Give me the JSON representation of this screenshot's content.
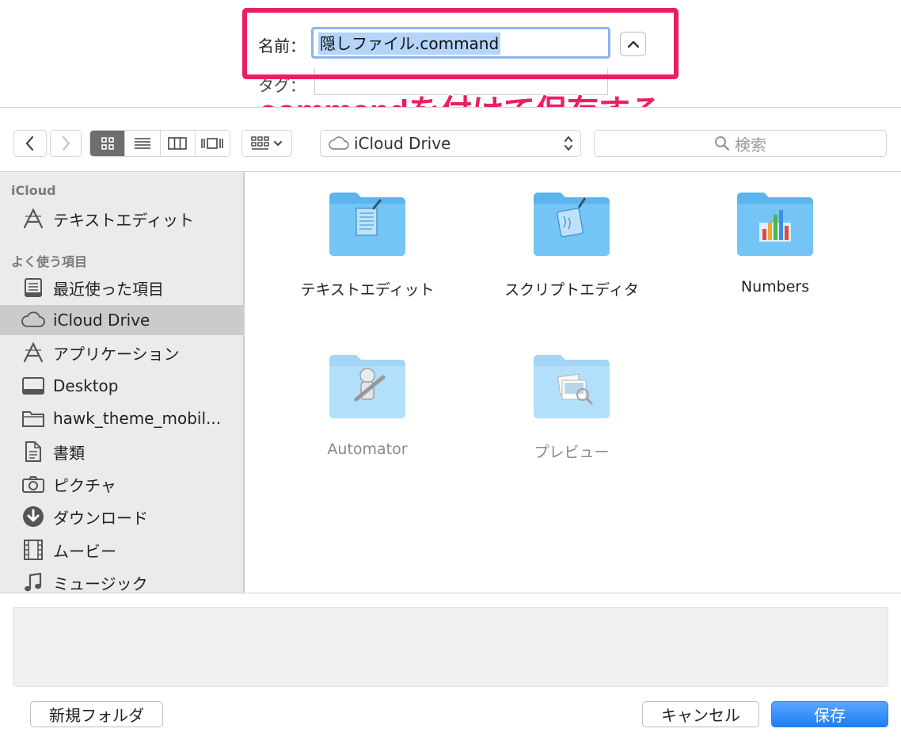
{
  "save_panel": {
    "name_label": "名前：",
    "name_value": "隠しファイル.command",
    "tag_label": "タグ：",
    "annotation": ".commandを付けて保存する",
    "annotation_color": "#ea1f63"
  },
  "toolbar": {
    "location": "iCloud Drive",
    "search_placeholder": "検索"
  },
  "sidebar": {
    "sections": [
      {
        "heading": "iCloud",
        "items": [
          {
            "label": "テキストエディット",
            "icon": "app-icon"
          }
        ]
      },
      {
        "heading": "よく使う項目",
        "items": [
          {
            "label": "最近使った項目",
            "icon": "recents-icon"
          },
          {
            "label": "iCloud Drive",
            "icon": "cloud-icon",
            "selected": true
          },
          {
            "label": "アプリケーション",
            "icon": "app-icon"
          },
          {
            "label": "Desktop",
            "icon": "desktop-icon"
          },
          {
            "label": "hawk_theme_mobil...",
            "icon": "folder-icon"
          },
          {
            "label": "書類",
            "icon": "document-icon"
          },
          {
            "label": "ピクチャ",
            "icon": "camera-icon"
          },
          {
            "label": "ダウンロード",
            "icon": "download-icon"
          },
          {
            "label": "ムービー",
            "icon": "film-icon"
          },
          {
            "label": "ミュージック",
            "icon": "music-icon"
          }
        ]
      }
    ]
  },
  "files": [
    {
      "name": "テキストエディット",
      "icon": "textedit-folder-icon",
      "enabled": true
    },
    {
      "name": "スクリプトエディタ",
      "icon": "script-editor-folder-icon",
      "enabled": true
    },
    {
      "name": "Numbers",
      "icon": "numbers-folder-icon",
      "enabled": true
    },
    {
      "name": "Automator",
      "icon": "automator-folder-icon",
      "enabled": false
    },
    {
      "name": "プレビュー",
      "icon": "preview-folder-icon",
      "enabled": false
    }
  ],
  "buttons": {
    "new_folder": "新規フォルダ",
    "cancel": "キャンセル",
    "save": "保存"
  },
  "colors": {
    "accent": "#1d7ef5",
    "folder": "#6fc0f5",
    "highlight_box": "#ea1f63",
    "selection": "#b4d4fc"
  }
}
